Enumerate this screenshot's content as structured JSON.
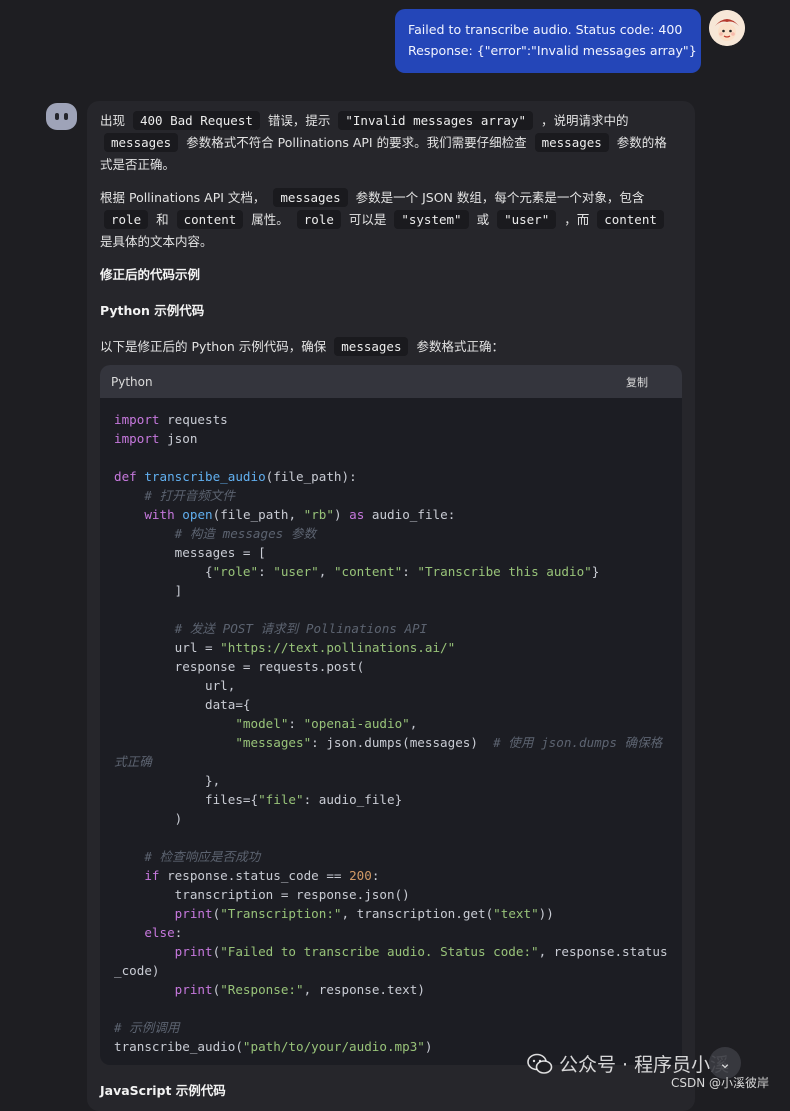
{
  "user_message": {
    "line1": "Failed to transcribe audio. Status code: 400",
    "line2": "Response: {\"error\":\"Invalid messages array\"}"
  },
  "assistant": {
    "p1": [
      "出现",
      "400 Bad Request",
      "错误，提示",
      "\"Invalid messages array\"",
      "，说明请求中的",
      "messages",
      "参数格式不符合 Pollinations API 的要求。我们需要仔细检查",
      "messages",
      "参数的格式是否正确。"
    ],
    "p2": [
      "根据 Pollinations API 文档，",
      "messages",
      "参数是一个 JSON 数组，每个元素是一个对象，包含",
      "role",
      "和",
      "content",
      "属性。",
      "role",
      "可以是",
      "\"system\"",
      "或",
      "\"user\"",
      "，而",
      "content",
      "是具体的文本内容。"
    ],
    "heading1": "修正后的代码示例",
    "heading2": "Python 示例代码",
    "p3": [
      "以下是修正后的 Python 示例代码，确保",
      "messages",
      "参数格式正确："
    ],
    "code_lang": "Python",
    "copy_label": "复制",
    "heading3": "JavaScript 示例代码"
  },
  "watermark": {
    "text": "公众号 · 程序员小溪",
    "csdn": "CSDN @小溪彼岸"
  },
  "icons": {
    "assistant": "robot-avatar-icon",
    "user": "user-avatar-icon",
    "scroll": "chevron-down-icon",
    "wechat": "wechat-icon"
  }
}
